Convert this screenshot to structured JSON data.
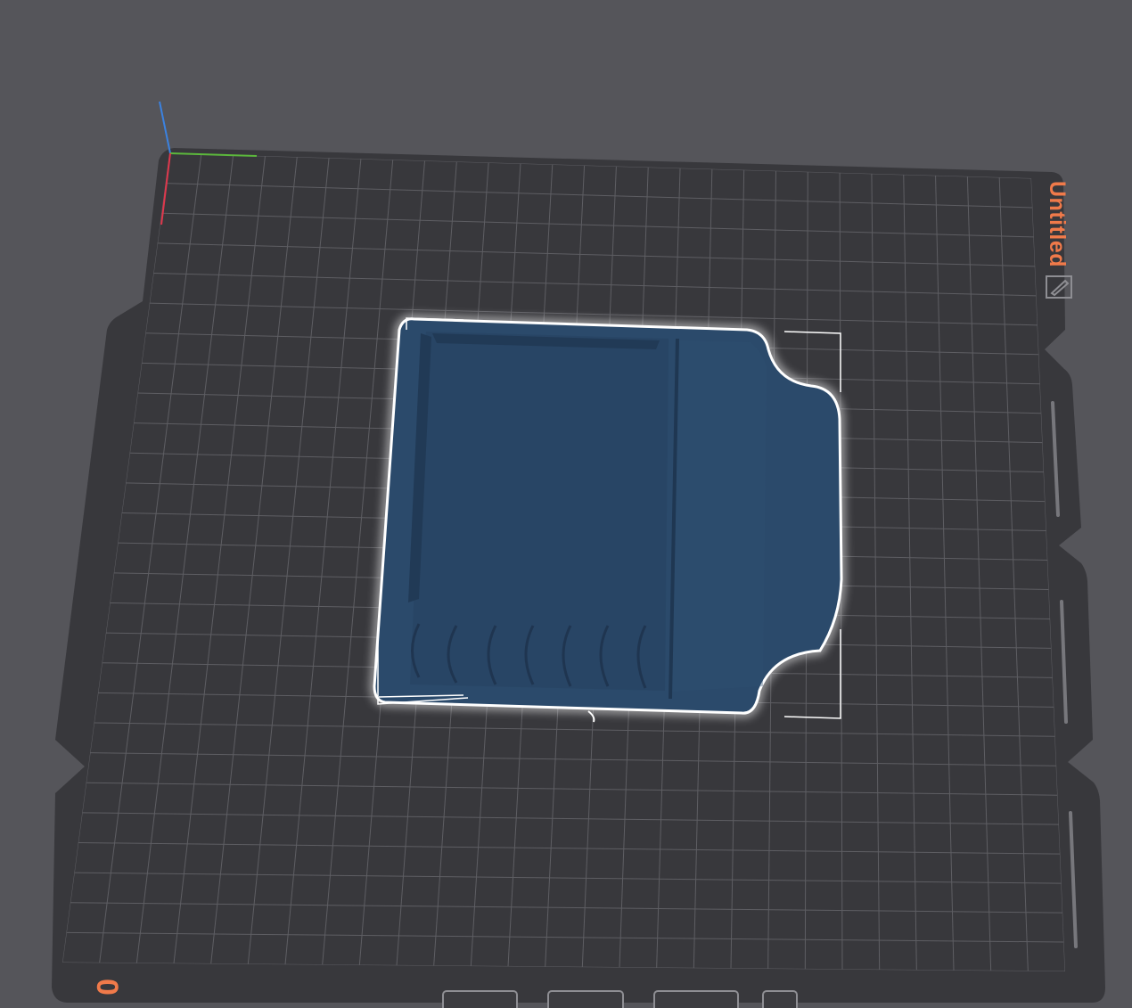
{
  "plate": {
    "name": "Untitled",
    "index": "0"
  },
  "colors": {
    "background": "#55555a",
    "bed": "#38383c",
    "grid": "#5e5e63",
    "model": "#2b4a6b",
    "selection": "#ffffff",
    "accent": "#f07a4a",
    "axis_x": "#e0374c",
    "axis_y": "#5cb83c",
    "axis_z": "#3b82e0"
  },
  "icons": {
    "edit": "pencil-edit-icon"
  }
}
